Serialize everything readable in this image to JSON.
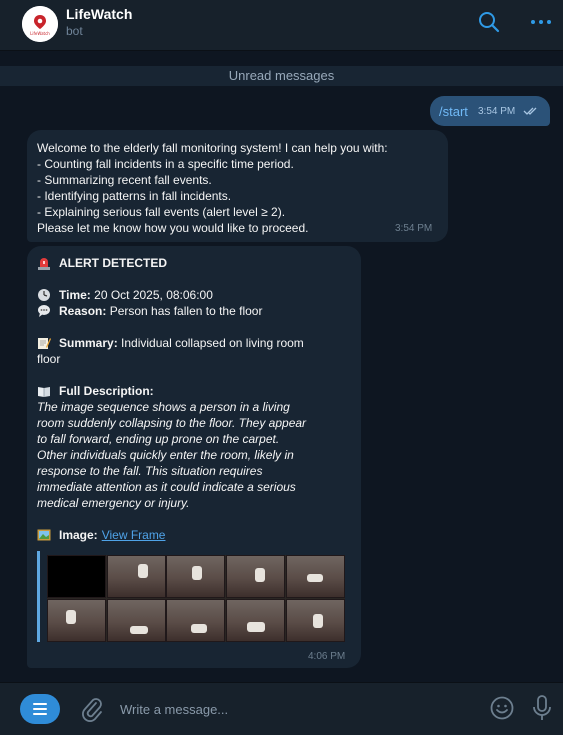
{
  "header": {
    "title": "LifeWatch",
    "subtitle": "bot",
    "avatar_text": "LifeWatch"
  },
  "chat": {
    "unread_label": "Unread messages",
    "outgoing": {
      "command": "/start",
      "time": "3:54 PM",
      "status": "read-double-check-icon"
    },
    "welcome": {
      "lines": [
        "Welcome to the elderly fall monitoring system! I can help you with:",
        "- Counting fall incidents in a specific time period.",
        "- Summarizing recent fall events.",
        "- Identifying patterns in fall incidents.",
        "- Explaining serious fall events (alert level ≥ 2).",
        "Please let me know how you would like to proceed."
      ],
      "time": "3:54 PM"
    },
    "alert": {
      "heading": "ALERT DETECTED",
      "time_label": "Time:",
      "time_value": "20 Oct 2025, 08:06:00",
      "reason_label": "Reason:",
      "reason_value": "Person has fallen to the floor",
      "summary_label": "Summary:",
      "summary_line1": "Individual collapsed on living room",
      "summary_line2": "floor",
      "description_label": "Full Description:",
      "description_lines": [
        "The image sequence shows a person in a living",
        "room suddenly collapsing to the floor. They appear",
        "to fall forward, ending up prone on the carpet.",
        "Other individuals quickly enter the room, likely in",
        "response to the fall. This situation requires",
        "immediate attention as it could indicate a serious",
        "medical emergency or injury."
      ],
      "image_label": "Image:",
      "image_link": "View Frame",
      "time": "4:06 PM"
    }
  },
  "composer": {
    "placeholder": "Write a message..."
  },
  "colors": {
    "background": "#0e1621",
    "header": "#17212b",
    "bubble_in": "#182533",
    "bubble_out": "#2b5278",
    "accent": "#2f8cd8",
    "link": "#4fa3e8"
  }
}
